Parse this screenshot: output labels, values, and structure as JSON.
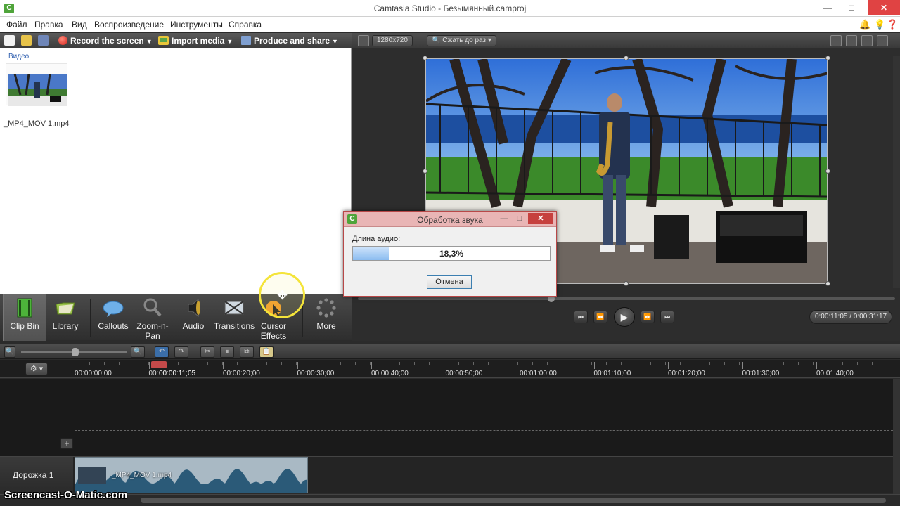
{
  "window": {
    "title": "Camtasia Studio - Безымянный.camproj",
    "min_glyph": "—",
    "max_glyph": "□",
    "close_glyph": "✕"
  },
  "menu": {
    "items": [
      "Файл",
      "Правка",
      "Вид",
      "Воспроизведение",
      "Инструменты",
      "Справка"
    ]
  },
  "toolbar": {
    "record": "Record the screen",
    "import": "Import media",
    "produce": "Produce and share"
  },
  "clip_bin": {
    "section_label": "Видео",
    "clip_name": "_MP4_MOV 1.mp4"
  },
  "tabs": [
    {
      "label": "Clip Bin",
      "icon": "film-strip-icon"
    },
    {
      "label": "Library",
      "icon": "folder-icon"
    },
    {
      "label": "Callouts",
      "icon": "speech-bubble-icon"
    },
    {
      "label": "Zoom-n-\nPan",
      "icon": "magnifier-icon"
    },
    {
      "label": "Audio",
      "icon": "speaker-icon"
    },
    {
      "label": "Transitions",
      "icon": "transition-icon"
    },
    {
      "label": "Cursor\nEffects",
      "icon": "cursor-icon"
    },
    {
      "label": "More",
      "icon": "dots-circle-icon"
    }
  ],
  "preview": {
    "dimensions": "1280x720",
    "zoom": "Сжать до раз",
    "timecode": "0:00:11:05 / 0:00:31:17"
  },
  "dialog": {
    "title": "Обработка звука",
    "label": "Длина аудио:",
    "progress_text": "18,3%",
    "progress_value": 18.3,
    "cancel": "Отмена"
  },
  "timeline": {
    "playhead_time": "00:00:11;05",
    "ruler": [
      "00:00:00;00",
      "00:",
      "00:00:20;00",
      "00:00:30;00",
      "00:00:40;00",
      "00:00:50;00",
      "00:01:00;00",
      "00:01:10;00",
      "00:01:20;00",
      "00:01:30;00",
      "00:01:40;00"
    ],
    "track_name": "Дорожка 1",
    "clip_name": "_MP4_MOV 1.mp4"
  },
  "watermark": "Screencast-O-Matic.com",
  "colors": {
    "accent_green": "#4fa43a",
    "close_red": "#e04343",
    "clip_bg": "#a9b9c4"
  }
}
